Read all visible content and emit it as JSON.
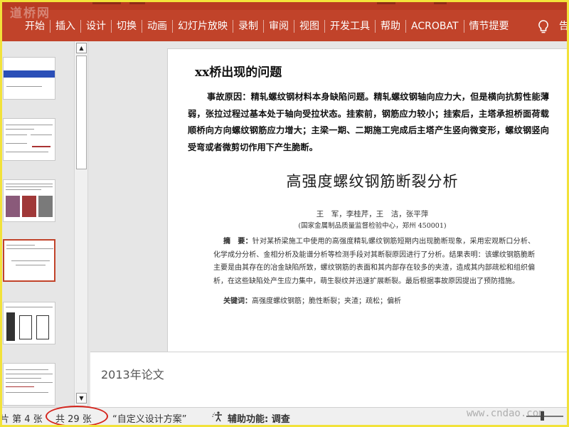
{
  "ribbon": {
    "watermark": "道桥网",
    "tabs": [
      "开始",
      "插入",
      "设计",
      "切换",
      "动画",
      "幻灯片放映",
      "录制",
      "审阅",
      "视图",
      "开发工具",
      "帮助",
      "ACROBAT",
      "情节提要"
    ],
    "tell_me_icon": "lightbulb-icon",
    "overflow_text": "告",
    "colors": {
      "ribbon": "#c1432a",
      "text": "#ffffff"
    }
  },
  "slide": {
    "title": "xx桥出现的问题",
    "body": "事故原因：精轧螺纹钢材料本身缺陷问题。精轧螺纹钢轴向应力大，但是横向抗剪性能薄弱，张拉过程过基本处于轴向受拉状态。挂索前，钢筋应力较小；挂索后，主塔承担桥面荷载顺桥向方向螺纹钢筋应力增大；主梁一期、二期施工完成后主塔产生竖向微变形，螺纹钢竖向受弯或者微剪切作用下产生脆断。",
    "paper": {
      "title": "高强度螺纹钢筋断裂分析",
      "authors": "王　军，李桂芹，王　洁，张平萍",
      "affiliation": "(国家金属制品质量监督检验中心，郑州 450001)",
      "abstract_label": "摘　要：",
      "abstract": "针对某桥梁施工中使用的高强度精轧螺纹钢筋短期内出现脆断现象，采用宏观断口分析、化学成分分析、金相分析及能谱分析等检测手段对其断裂原因进行了分析。结果表明：该螺纹钢筋脆断主要是由其存在的冶金缺陷所致，螺纹钢筋的表面和其内部存在较多的夹渣，造成其内部疏松和组织偏析，在这些缺陷处产生应力集中，萌生裂纹并迅速扩展断裂。最后根据事故原因提出了预防措施。",
      "keywords_label": "关键词：",
      "keywords": "高强度螺纹钢筋；脆性断裂；夹渣；疏松；偏析"
    }
  },
  "notes": {
    "text": "2013年论文"
  },
  "status": {
    "slide_index_partial": "片 第 4 张",
    "slide_total": "共 29 张",
    "theme": "“自定义设计方案”",
    "accessibility_label": "辅助功能: 调查",
    "site_watermark": "www.cndao.com"
  },
  "thumbnails": {
    "selected_index": 4,
    "count_visible": 6
  },
  "annotation_color": "#d4241c"
}
